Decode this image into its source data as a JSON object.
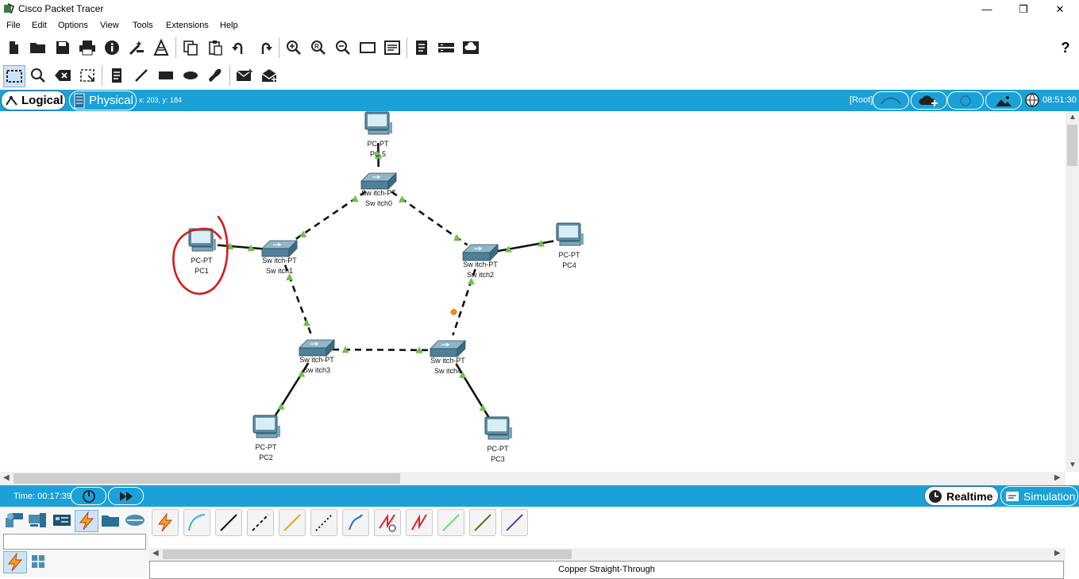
{
  "window": {
    "title": "Cisco Packet Tracer",
    "min": "—",
    "max": "❐",
    "close": "✕"
  },
  "menu": [
    "File",
    "Edit",
    "Options",
    "View",
    "Tools",
    "Extensions",
    "Help"
  ],
  "toolbar1": {
    "icons": [
      "new-file-icon",
      "open-folder-icon",
      "save-icon",
      "print-icon",
      "info-icon",
      "activity-wizard-icon",
      "network-info-icon",
      "copy-icon",
      "paste-icon",
      "undo-icon",
      "redo-icon",
      "zoom-in-icon",
      "zoom-reset-icon",
      "zoom-out-icon",
      "drawing-palette-icon",
      "custom-device-dialog-icon",
      "pdu-list-icon",
      "network-device-icon",
      "cloud-view-icon"
    ],
    "help": "?"
  },
  "toolbar2": {
    "icons": [
      "select-icon",
      "inspect-icon",
      "delete-icon",
      "resize-shape-icon",
      "place-note-icon",
      "draw-line-icon",
      "draw-rectangle-icon",
      "draw-ellipse-icon",
      "freeform-icon",
      "add-simple-pdu-icon",
      "add-complex-pdu-icon"
    ]
  },
  "topbar": {
    "logical": "Logical",
    "physical": "Physical",
    "coords": "x: 203, y: 184",
    "root": "[Root]",
    "time": "08:51:30"
  },
  "devices": [
    {
      "id": "pc5",
      "type": "PC-PT",
      "name": "PC 5",
      "kind": "pc"
    },
    {
      "id": "switch0",
      "type": "Sw itch-PT",
      "name": "Sw itch0",
      "kind": "switch"
    },
    {
      "id": "pc1",
      "type": "PC-PT",
      "name": "PC1",
      "kind": "pc"
    },
    {
      "id": "switch1",
      "type": "Sw itch-PT",
      "name": "Sw itch1",
      "kind": "switch"
    },
    {
      "id": "switch2",
      "type": "Sw itch-PT",
      "name": "Sw itch2",
      "kind": "switch"
    },
    {
      "id": "pc4",
      "type": "PC-PT",
      "name": "PC4",
      "kind": "pc"
    },
    {
      "id": "switch3",
      "type": "Sw itch-PT",
      "name": "Sw itch3",
      "kind": "switch"
    },
    {
      "id": "switch4",
      "type": "Sw itch-PT",
      "name": "Sw itch4",
      "kind": "switch"
    },
    {
      "id": "pc2",
      "type": "PC-PT",
      "name": "PC2",
      "kind": "pc"
    },
    {
      "id": "pc3",
      "type": "PC-PT",
      "name": "PC3",
      "kind": "pc"
    }
  ],
  "links": [
    {
      "from": "pc5",
      "to": "switch0",
      "style": "straight"
    },
    {
      "from": "switch0",
      "to": "switch1",
      "style": "crossover"
    },
    {
      "from": "switch0",
      "to": "switch2",
      "style": "crossover"
    },
    {
      "from": "pc1",
      "to": "switch1",
      "style": "straight"
    },
    {
      "from": "switch2",
      "to": "pc4",
      "style": "straight"
    },
    {
      "from": "switch1",
      "to": "switch3",
      "style": "crossover"
    },
    {
      "from": "switch3",
      "to": "switch4",
      "style": "crossover"
    },
    {
      "from": "switch2",
      "to": "switch4",
      "style": "crossover",
      "blocked": true
    },
    {
      "from": "switch3",
      "to": "pc2",
      "style": "straight"
    },
    {
      "from": "switch4",
      "to": "pc3",
      "style": "straight"
    }
  ],
  "colors": {
    "accent": "#1ba1d8",
    "link_up": "#6cc04a",
    "link_blocked": "#f08a1c",
    "annotation": "#d6191b"
  },
  "simbar": {
    "time": "Time: 00:17:39",
    "realtime": "Realtime",
    "simulation": "Simulation"
  },
  "bottom": {
    "categories": [
      "network-devices-icon",
      "end-devices-icon",
      "components-icon",
      "connections-icon",
      "miscellaneous-icon",
      "multiuser-icon"
    ],
    "subcategories": [
      "connections-icon",
      "grid-icon"
    ],
    "cables": [
      {
        "name": "automatic-cable",
        "color": "#e8a000"
      },
      {
        "name": "console-cable",
        "color": "#2bb8d8"
      },
      {
        "name": "copper-straight-through",
        "color": "#111111"
      },
      {
        "name": "copper-cross-over",
        "color": "#111111"
      },
      {
        "name": "fiber",
        "color": "#f0a020"
      },
      {
        "name": "phone",
        "color": "#111111"
      },
      {
        "name": "coaxial",
        "color": "#1e70d6"
      },
      {
        "name": "serial-dce",
        "color": "#e0202a"
      },
      {
        "name": "serial-dte",
        "color": "#e0202a"
      },
      {
        "name": "octal",
        "color": "#6ee06e"
      },
      {
        "name": "iot-custom",
        "color": "#6e6a1a"
      },
      {
        "name": "usb",
        "color": "#6a3ab8"
      }
    ],
    "caption": "Copper Straight-Through"
  }
}
